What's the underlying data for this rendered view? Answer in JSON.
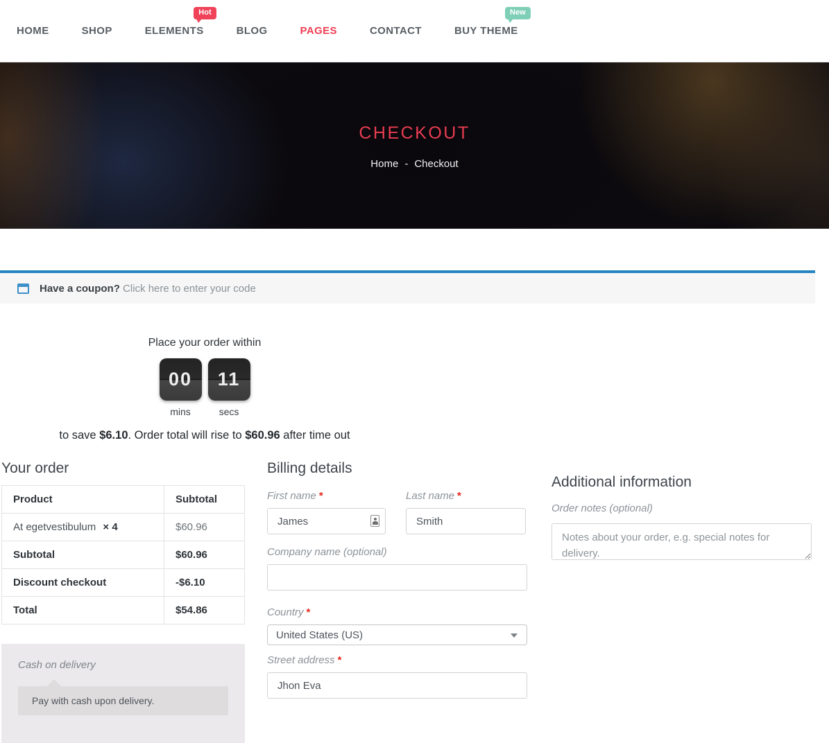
{
  "colors": {
    "accent_red": "#ee3e53",
    "coupon_border_blue": "#2484c2",
    "badge_hot": "#f0435a",
    "badge_new": "#7fcfb7",
    "payment_bg": "#ebe9eb"
  },
  "nav": {
    "items": [
      {
        "label": "HOME"
      },
      {
        "label": "SHOP"
      },
      {
        "label": "ELEMENTS",
        "badge": "Hot"
      },
      {
        "label": "BLOG"
      },
      {
        "label": "PAGES"
      },
      {
        "label": "CONTACT"
      },
      {
        "label": "BUY THEME",
        "badge": "New"
      }
    ]
  },
  "hero": {
    "title": "CHECKOUT",
    "breadcrumb": {
      "home": "Home",
      "separator": "-",
      "current": "Checkout"
    }
  },
  "coupon": {
    "question": "Have a coupon?",
    "link": "Click here to enter your code"
  },
  "countdown": {
    "heading": "Place your order within",
    "minutes": "00",
    "seconds": "11",
    "minutes_label": "mins",
    "seconds_label": "secs",
    "save_prefix": "to save ",
    "save_amount": "$6.10",
    "save_middle": ". Order total will rise to ",
    "rise_amount": "$60.96",
    "save_suffix": " after time out"
  },
  "order": {
    "heading": "Your order",
    "col_product": "Product",
    "col_subtotal": "Subtotal",
    "product_name": "At egetvestibulum",
    "product_qty": "× 4",
    "product_price": "$60.96",
    "rows": [
      {
        "label": "Subtotal",
        "value": "$60.96"
      },
      {
        "label": "Discount checkout",
        "value": "-$6.10"
      },
      {
        "label": "Total",
        "value": "$54.86"
      }
    ],
    "payment": {
      "method": "Cash on delivery",
      "description": "Pay with cash upon delivery."
    }
  },
  "billing": {
    "heading": "Billing details",
    "required_mark": "*",
    "first_name": {
      "label": "First name",
      "value": "James"
    },
    "last_name": {
      "label": "Last name",
      "value": "Smith"
    },
    "company": {
      "label": "Company name (optional)",
      "value": ""
    },
    "country": {
      "label": "Country",
      "value": "United States (US)"
    },
    "street": {
      "label": "Street address",
      "value": "Jhon Eva"
    }
  },
  "additional": {
    "heading": "Additional information",
    "order_notes_label": "Order notes (optional)",
    "order_notes_placeholder": "Notes about your order, e.g. special notes for delivery."
  }
}
